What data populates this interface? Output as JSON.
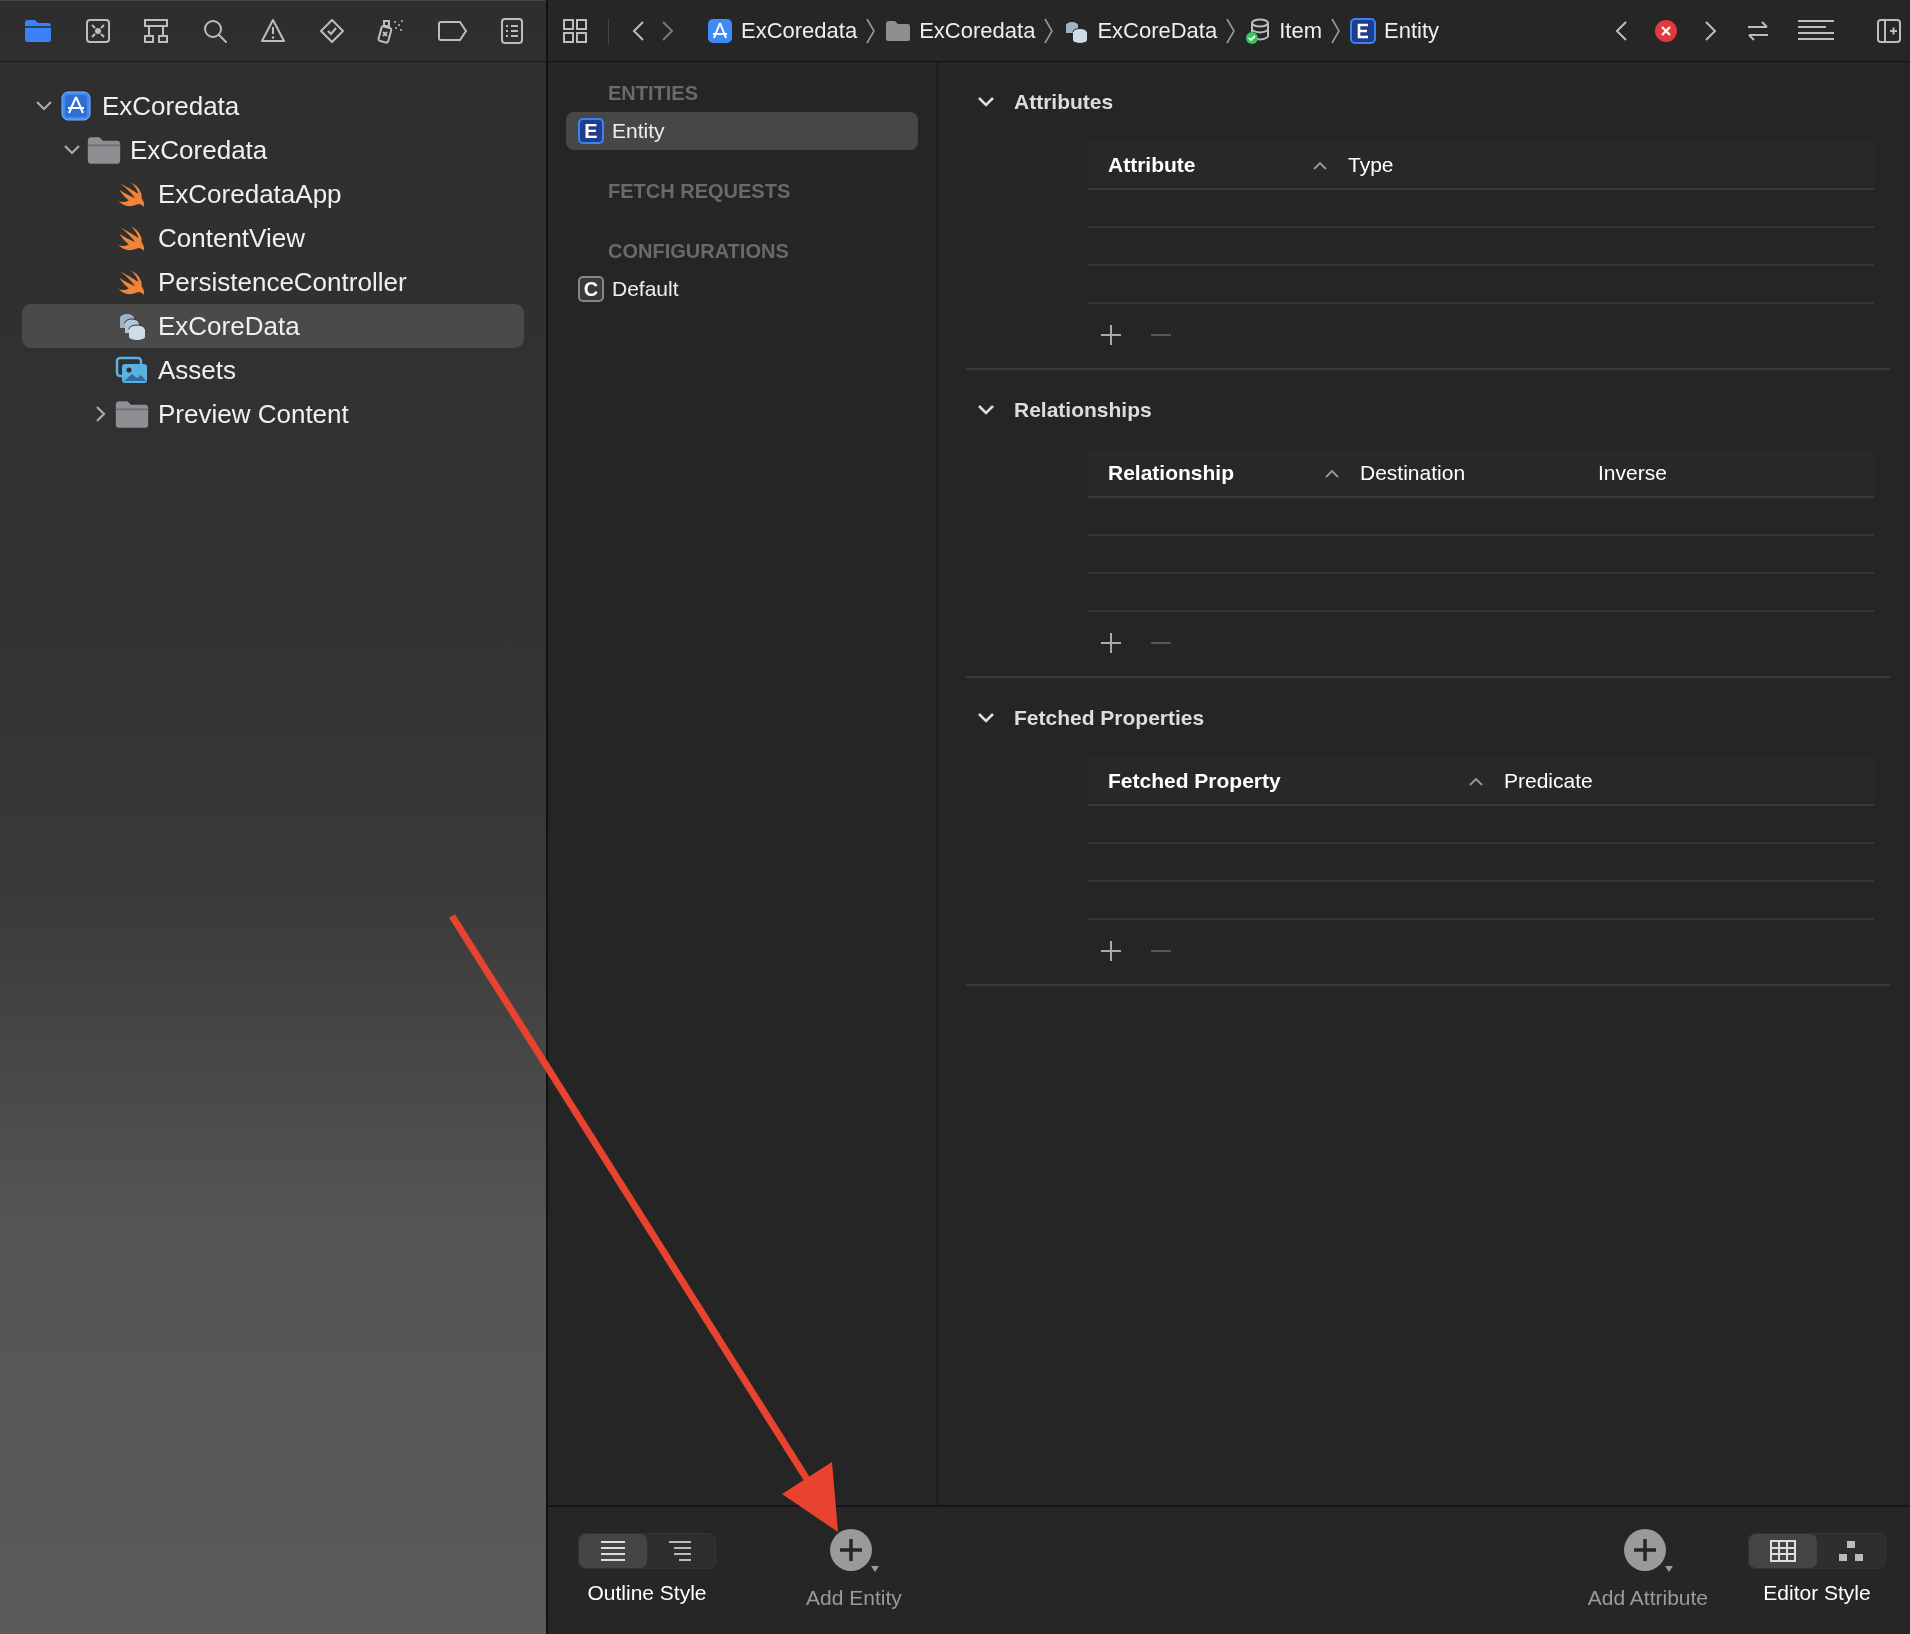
{
  "navigator_tabs": [
    {
      "kind": "folder",
      "selected": true
    },
    {
      "kind": "crosshair",
      "selected": false
    },
    {
      "kind": "hierarchy",
      "selected": false
    },
    {
      "kind": "search",
      "selected": false
    },
    {
      "kind": "warning",
      "selected": false
    },
    {
      "kind": "diamond",
      "selected": false
    },
    {
      "kind": "spray",
      "selected": false
    },
    {
      "kind": "tag",
      "selected": false
    },
    {
      "kind": "list",
      "selected": false
    }
  ],
  "project_tree": [
    {
      "label": "ExCoredata",
      "kind": "project",
      "expanded": true,
      "selected": false,
      "children": [
        {
          "label": "ExCoredata",
          "kind": "folder",
          "expanded": true,
          "selected": false,
          "children": [
            {
              "label": "ExCoredataApp",
              "kind": "swift",
              "selected": false
            },
            {
              "label": "ContentView",
              "kind": "swift",
              "selected": false
            },
            {
              "label": "PersistenceController",
              "kind": "swift",
              "selected": false
            },
            {
              "label": "ExCoreData",
              "kind": "model",
              "selected": true
            },
            {
              "label": "Assets",
              "kind": "assets",
              "selected": false
            },
            {
              "label": "Preview Content",
              "kind": "folder",
              "expanded": false,
              "selected": false
            }
          ]
        }
      ]
    }
  ],
  "breadcrumbs": [
    {
      "kind": "project",
      "label": "ExCoredata"
    },
    {
      "kind": "folder",
      "label": "ExCoredata"
    },
    {
      "kind": "model",
      "label": "ExCoreData"
    },
    {
      "kind": "version",
      "label": "Item"
    },
    {
      "kind": "entity",
      "label": "Entity"
    }
  ],
  "entity_list": {
    "sections": [
      {
        "title": "ENTITIES",
        "items": [
          {
            "kind": "entity",
            "badge": "E",
            "label": "Entity",
            "selected": true
          }
        ]
      },
      {
        "title": "FETCH REQUESTS"
      },
      {
        "title": "CONFIGURATIONS",
        "items": [
          {
            "kind": "configuration",
            "badge": "C",
            "label": "Default",
            "selected": false
          }
        ]
      }
    ]
  },
  "detail_sections": [
    {
      "title": "Attributes",
      "expanded": true,
      "columns": [
        {
          "label": "Attribute",
          "sorted": true
        },
        {
          "label": "Type",
          "sorted": false
        }
      ]
    },
    {
      "title": "Relationships",
      "expanded": true,
      "columns": [
        {
          "label": "Relationship",
          "sorted": true
        },
        {
          "label": "Destination",
          "sorted": false
        },
        {
          "label": "Inverse",
          "sorted": false
        }
      ]
    },
    {
      "title": "Fetched Properties",
      "expanded": true,
      "columns": [
        {
          "label": "Fetched Property",
          "sorted": true
        },
        {
          "label": "Predicate",
          "sorted": false
        }
      ]
    }
  ],
  "bottom_bar": [
    {
      "kind": "segmented",
      "label": "Outline Style",
      "segments": [
        {
          "kind": "table",
          "selected": true
        },
        {
          "kind": "outline",
          "selected": false
        }
      ]
    },
    {
      "kind": "add",
      "label": "Add Entity"
    },
    {
      "kind": "spacer"
    },
    {
      "kind": "add",
      "label": "Add Attribute"
    },
    {
      "kind": "segmented",
      "label": "Editor Style",
      "segments": [
        {
          "kind": "grid",
          "selected": true
        },
        {
          "kind": "graph",
          "selected": false
        }
      ]
    }
  ],
  "annotation": {
    "kind": "arrow"
  }
}
